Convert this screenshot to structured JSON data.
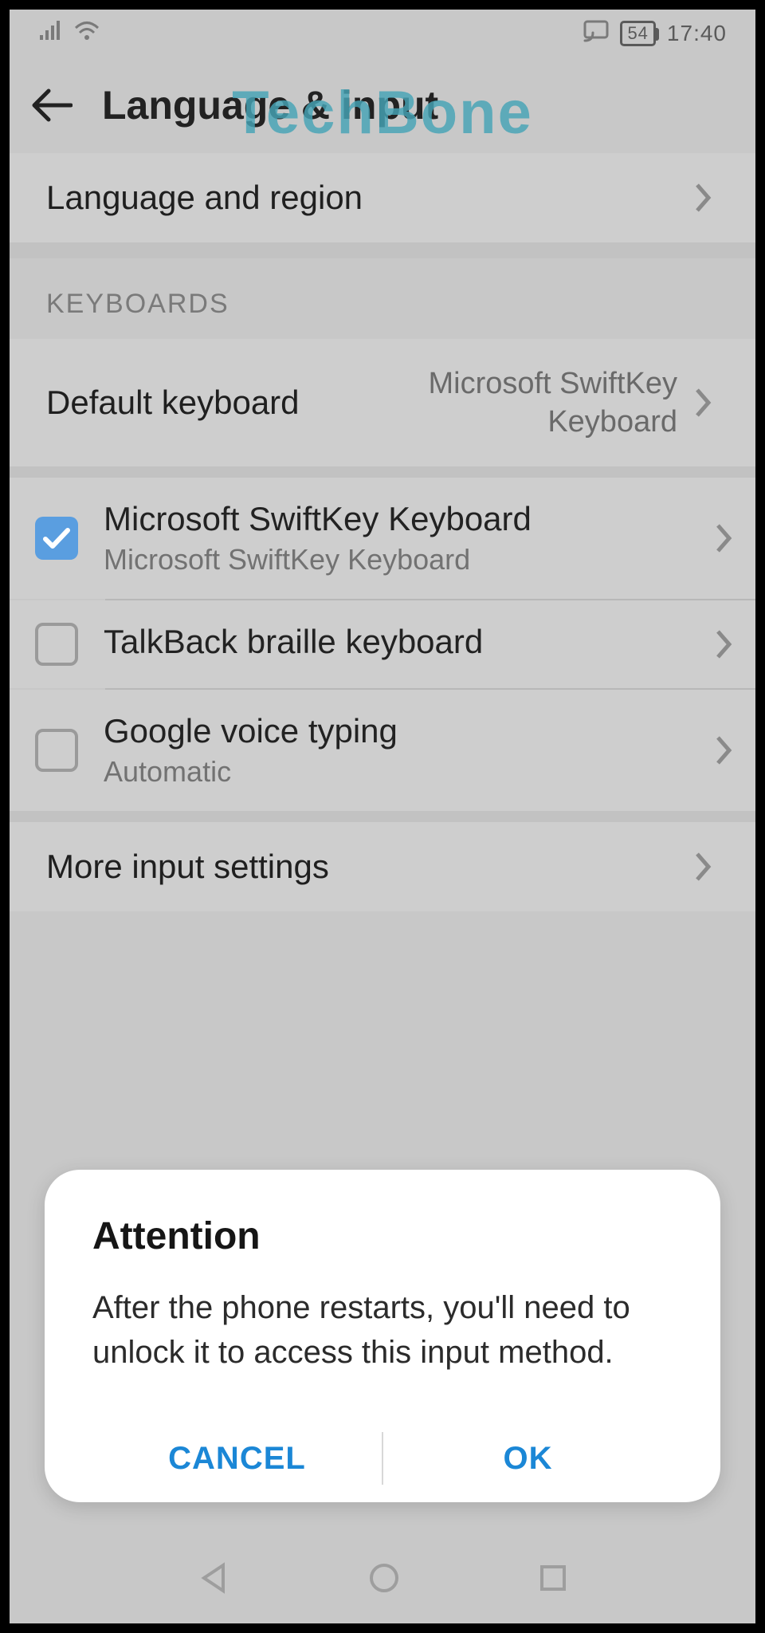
{
  "status": {
    "battery": "54",
    "time": "17:40"
  },
  "watermark": "TechBone",
  "header": {
    "title": "Language & input"
  },
  "rows": {
    "language_region": "Language and region",
    "more_input": "More input settings"
  },
  "keyboards": {
    "section_label": "KEYBOARDS",
    "default_label": "Default keyboard",
    "default_value": "Microsoft SwiftKey Keyboard",
    "items": [
      {
        "title": "Microsoft SwiftKey Keyboard",
        "sub": "Microsoft SwiftKey Keyboard",
        "checked": true
      },
      {
        "title": "TalkBack braille keyboard",
        "sub": "",
        "checked": false
      },
      {
        "title": "Google voice typing",
        "sub": "Automatic",
        "checked": false
      }
    ]
  },
  "dialog": {
    "title": "Attention",
    "message": "After the phone restarts, you'll need to unlock it to access this input method.",
    "cancel": "CANCEL",
    "ok": "OK"
  }
}
